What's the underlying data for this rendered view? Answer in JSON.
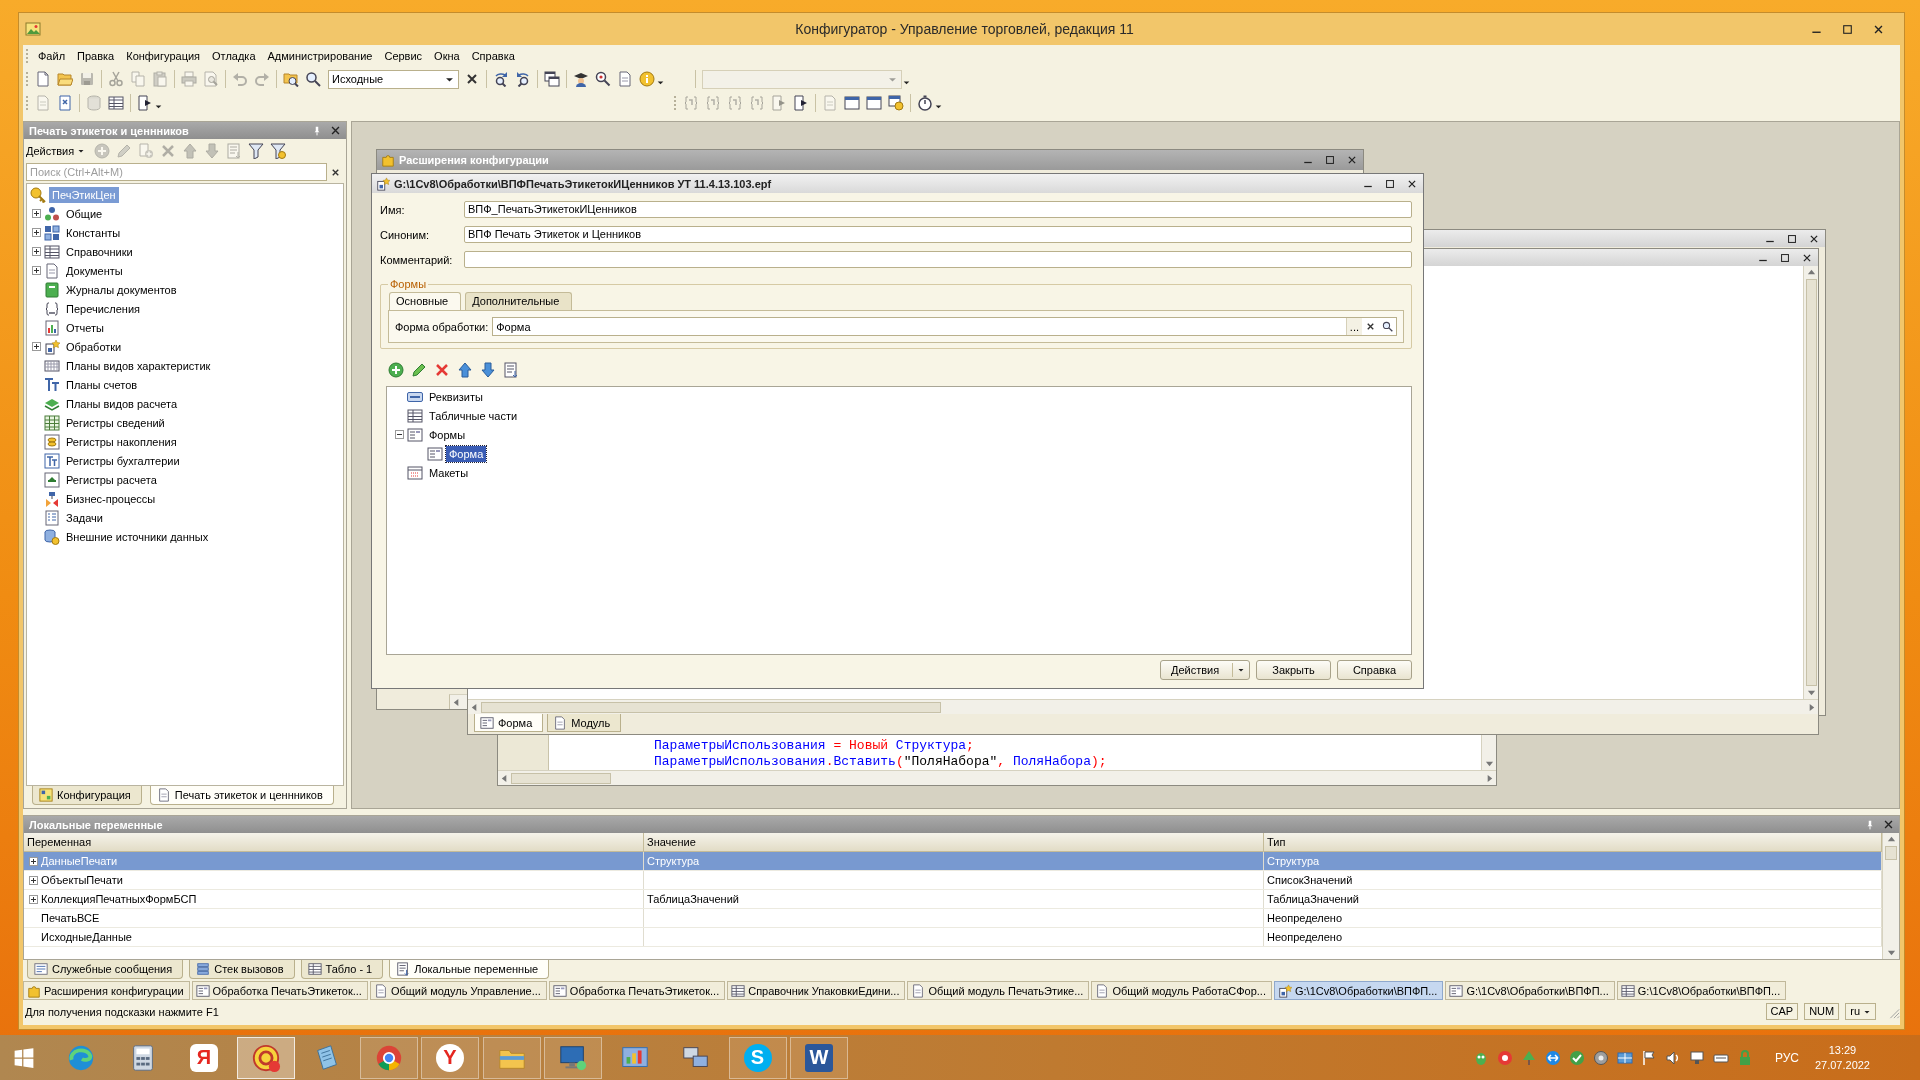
{
  "window": {
    "title": "Конфигуратор - Управление торговлей, редакция 11"
  },
  "menu": [
    "Файл",
    "Правка",
    "Конфигурация",
    "Отладка",
    "Администрирование",
    "Сервис",
    "Окна",
    "Справка"
  ],
  "toolbar_1": {
    "groups": [
      [
        {
          "disabled": false
        },
        {
          "disabled": false
        },
        {
          "disabled": true
        }
      ],
      [
        {
          "disabled": true
        },
        {
          "disabled": true
        },
        {
          "disabled": true
        }
      ],
      [
        {
          "disabled": true
        },
        {
          "disabled": true
        }
      ],
      [
        {
          "disabled": true
        },
        {
          "disabled": true
        }
      ],
      [
        {
          "disabled": false
        },
        {
          "disabled": false
        }
      ]
    ],
    "combo": {
      "value": "Исходные"
    },
    "groups_after": [
      [
        {
          "disabled": false
        },
        {
          "disabled": false
        }
      ],
      [
        {
          "disabled": false
        }
      ],
      [
        {
          "disabled": false
        },
        {
          "disabled": false
        },
        {
          "disabled": false
        },
        {
          "disabled": false
        }
      ]
    ],
    "module_combo": {
      "disabled": true
    }
  },
  "toolbar_2": {
    "groups_left": [
      [
        {
          "disabled": true
        },
        {
          "disabled": false
        }
      ],
      [
        {
          "disabled": true
        },
        {
          "disabled": false
        }
      ],
      [
        {
          "disabled": false
        }
      ]
    ],
    "groups_right": [
      [
        {
          "disabled": true
        },
        {
          "disabled": true
        },
        {
          "disabled": true
        },
        {
          "disabled": true
        },
        {
          "disabled": true
        },
        {
          "disabled": false
        }
      ],
      [
        {
          "disabled": true
        },
        {
          "disabled": false
        },
        {
          "disabled": false
        },
        {
          "disabled": false
        }
      ],
      [
        {
          "disabled": false
        }
      ]
    ]
  },
  "left_panel": {
    "title": "Печать этикеток и ценнников",
    "actions_label": "Действия",
    "toolbar": [
      {
        "disabled": true
      },
      {
        "disabled": true
      },
      {
        "disabled": true
      },
      {
        "disabled": true
      },
      {
        "disabled": true
      },
      {
        "disabled": true
      },
      {
        "disabled": true
      },
      {
        "disabled": false
      },
      {
        "disabled": false
      }
    ],
    "search": {
      "placeholder": "Поиск (Ctrl+Alt+M)"
    },
    "tree": [
      {
        "label": "ПечЭтикЦен",
        "selected": true,
        "children": [
          {
            "label": "Общие",
            "expanded": false,
            "selected": false
          },
          {
            "label": "Константы",
            "expanded": false,
            "selected": false
          },
          {
            "label": "Справочники",
            "expanded": false,
            "selected": false
          },
          {
            "label": "Документы",
            "expanded": false,
            "selected": false
          },
          {
            "label": "Журналы документов",
            "selected": false
          },
          {
            "label": "Перечисления",
            "selected": false
          },
          {
            "label": "Отчеты",
            "selected": false
          },
          {
            "label": "Обработки",
            "expanded": false,
            "selected": false
          },
          {
            "label": "Планы видов характеристик",
            "selected": false
          },
          {
            "label": "Планы счетов",
            "selected": false
          },
          {
            "label": "Планы видов расчета",
            "selected": false
          },
          {
            "label": "Регистры сведений",
            "selected": false
          },
          {
            "label": "Регистры накопления",
            "selected": false
          },
          {
            "label": "Регистры бухгалтерии",
            "selected": false
          },
          {
            "label": "Регистры расчета",
            "selected": false
          },
          {
            "label": "Бизнес-процессы",
            "selected": false
          },
          {
            "label": "Задачи",
            "selected": false
          },
          {
            "label": "Внешние источники данных",
            "selected": false
          }
        ]
      }
    ],
    "tabs": [
      {
        "label": "Конфигурация",
        "selected": false
      },
      {
        "label": "Печать этикеток и ценнников",
        "selected": true
      }
    ]
  },
  "extensions_window": {
    "title": "Расширения конфигурации"
  },
  "form_window": {
    "tabs": [
      {
        "label": "Форма",
        "selected": true
      },
      {
        "label": "Модуль",
        "selected": false
      }
    ]
  },
  "code_window": {
    "lines": [
      {
        "tokens": [
          {
            "text": "ПараметрыИспользования",
            "kind": "identifier"
          },
          {
            "text": " = ",
            "kind": "operator"
          },
          {
            "text": "Новый",
            "kind": "keyword"
          },
          {
            "text": " Структура",
            "kind": "identifier"
          },
          {
            "text": ";",
            "kind": "operator"
          }
        ]
      },
      {
        "tokens": [
          {
            "text": "ПараметрыИспользования",
            "kind": "identifier"
          },
          {
            "text": ".",
            "kind": "operator"
          },
          {
            "text": "Вставить",
            "kind": "identifier"
          },
          {
            "text": "(",
            "kind": "operator"
          },
          {
            "text": "\"ПоляНабора\"",
            "kind": "string"
          },
          {
            "text": ", ",
            "kind": "operator"
          },
          {
            "text": "ПоляНабора",
            "kind": "identifier"
          },
          {
            "text": ");",
            "kind": "operator"
          }
        ]
      }
    ]
  },
  "dialog": {
    "title": "G:\\1Cv8\\Обработки\\ВПФПечатьЭтикетокИЦенников УТ 11.4.13.103.epf",
    "fields": [
      {
        "label": "Имя:",
        "value": "ВПФ_ПечатьЭтикетокИЦенников"
      },
      {
        "label": "Синоним:",
        "value": "ВПФ Печать Этикеток и Ценников"
      },
      {
        "label": "Комментарий:"
      }
    ],
    "forms_group": {
      "title": "Формы",
      "tabs": [
        {
          "label": "Основные",
          "selected": true
        },
        {
          "label": "Дополнительные",
          "selected": false
        }
      ],
      "form_field": {
        "label": "Форма обработки:",
        "value": "Форма",
        "choose_button": "..."
      }
    },
    "tree": [
      {
        "label": "Реквизиты",
        "selected": false
      },
      {
        "label": "Табличные части",
        "selected": false
      },
      {
        "label": "Формы",
        "expanded": true,
        "selected": false,
        "children": [
          {
            "label": "Форма",
            "selected": true
          }
        ]
      },
      {
        "label": "Макеты",
        "selected": false
      }
    ],
    "buttons": [
      {
        "label": "Действия",
        "kind": "menu"
      },
      {
        "label": "Закрыть",
        "kind": "plain"
      },
      {
        "label": "Справка",
        "kind": "plain"
      }
    ]
  },
  "locals_panel": {
    "title": "Локальные переменные",
    "columns": [
      "Переменная",
      "Значение",
      "Тип"
    ],
    "rows": [
      {
        "name": "ДанныеПечати",
        "value": "Структура",
        "type": "Структура",
        "expanded": false,
        "selected": true
      },
      {
        "name": "ОбъектыПечати",
        "type": "СписокЗначений",
        "expanded": false,
        "selected": false
      },
      {
        "name": "КоллекцияПечатныхФормБСП",
        "value": "ТаблицаЗначений",
        "type": "ТаблицаЗначений",
        "expanded": false,
        "selected": false
      },
      {
        "name": "ПечатьВСЕ",
        "type": "Неопределено",
        "selected": false
      },
      {
        "name": "ИсходныеДанные",
        "type": "Неопределено",
        "selected": false
      }
    ]
  },
  "panel_tabs": [
    {
      "label": "Служебные сообщения",
      "selected": false
    },
    {
      "label": "Стек вызовов",
      "selected": false
    },
    {
      "label": "Табло - 1",
      "selected": false
    },
    {
      "label": "Локальные переменные",
      "selected": true
    }
  ],
  "window_tabs": [
    {
      "label": "Расширения конфигурации",
      "selected": false
    },
    {
      "label": "Обработка ПечатьЭтикеток...",
      "selected": false
    },
    {
      "label": "Общий модуль Управление...",
      "selected": false
    },
    {
      "label": "Обработка ПечатьЭтикеток...",
      "selected": false
    },
    {
      "label": "Справочник УпаковкиЕдини...",
      "selected": false
    },
    {
      "label": "Общий модуль ПечатьЭтике...",
      "selected": false
    },
    {
      "label": "Общий модуль РаботаСФор...",
      "selected": false
    },
    {
      "label": "G:\\1Cv8\\Обработки\\ВПФП...",
      "selected": true
    },
    {
      "label": "G:\\1Cv8\\Обработки\\ВПФП...",
      "selected": false
    },
    {
      "label": "G:\\1Cv8\\Обработки\\ВПФП...",
      "selected": false
    }
  ],
  "status_bar": {
    "hint": "Для получения подсказки нажмите F1",
    "indicators": [
      "CAP",
      "NUM"
    ],
    "language": "ru"
  },
  "taskbar": {
    "apps": [
      {
        "running": false,
        "selected": false
      },
      {
        "running": false,
        "selected": false
      },
      {
        "running": false,
        "selected": false,
        "glyph": "Я"
      },
      {
        "running": true,
        "selected": true
      },
      {
        "running": false,
        "selected": false
      },
      {
        "running": true,
        "selected": false
      },
      {
        "running": true,
        "selected": false,
        "glyph": "Y"
      },
      {
        "running": true,
        "selected": false
      },
      {
        "running": true,
        "selected": false
      },
      {
        "running": false,
        "selected": false
      },
      {
        "running": false,
        "selected": false
      },
      {
        "running": true,
        "selected": false,
        "glyph": "S"
      },
      {
        "running": true,
        "selected": false,
        "glyph": "W"
      }
    ],
    "tray": {
      "language": "РУС",
      "time": "13:29",
      "date": "27.07.2022"
    }
  }
}
